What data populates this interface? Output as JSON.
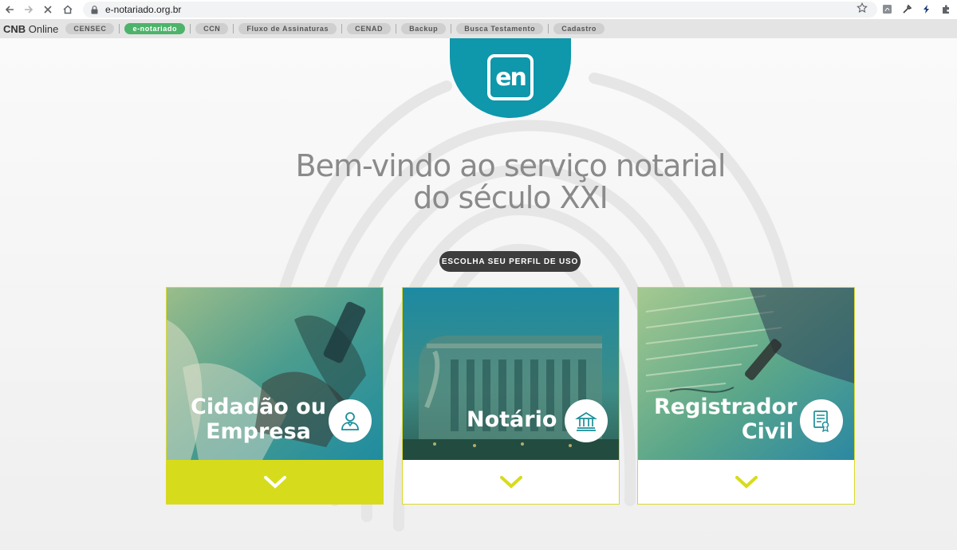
{
  "browser": {
    "url": "e-notariado.org.br",
    "bookmarks_brand": {
      "strong": "CNB",
      "rest": " Online"
    },
    "bookmarks": [
      {
        "label": "CENSEC",
        "active": false
      },
      {
        "label": "e-notariado",
        "active": true
      },
      {
        "label": "CCN",
        "active": false
      },
      {
        "label": "Fluxo de Assinaturas",
        "active": false
      },
      {
        "label": "CENAD",
        "active": false
      },
      {
        "label": "Backup",
        "active": false
      },
      {
        "label": "Busca Testamento",
        "active": false
      },
      {
        "label": "Cadastro",
        "active": false
      }
    ],
    "icons": [
      "back-icon",
      "forward-icon",
      "stop-icon",
      "home-icon",
      "lock-icon",
      "star-icon",
      "pdf-extension-icon",
      "eyedropper-extension-icon",
      "bolt-extension-icon",
      "puzzle-extension-icon"
    ]
  },
  "page": {
    "logo_text": "en",
    "headline_line1": "Bem-vindo ao serviço notarial",
    "headline_line2": "do século XXI",
    "profile_button": "ESCOLHA SEU PERFIL DE USO",
    "cards": [
      {
        "line1": "Cidadão ou",
        "line2": "Empresa",
        "icon": "citizen-icon",
        "expanded": true
      },
      {
        "line1": "Notário",
        "line2": "",
        "icon": "notary-building-icon",
        "expanded": false
      },
      {
        "line1": "Registrador",
        "line2": "Civil",
        "icon": "certificate-icon",
        "expanded": false
      }
    ]
  },
  "colors": {
    "teal": "#0f97ab",
    "accent_green": "#4db36b",
    "lime": "#d6dc1b",
    "pill_dark": "#3d3d3d",
    "headline_gray": "#8a8a8a"
  }
}
